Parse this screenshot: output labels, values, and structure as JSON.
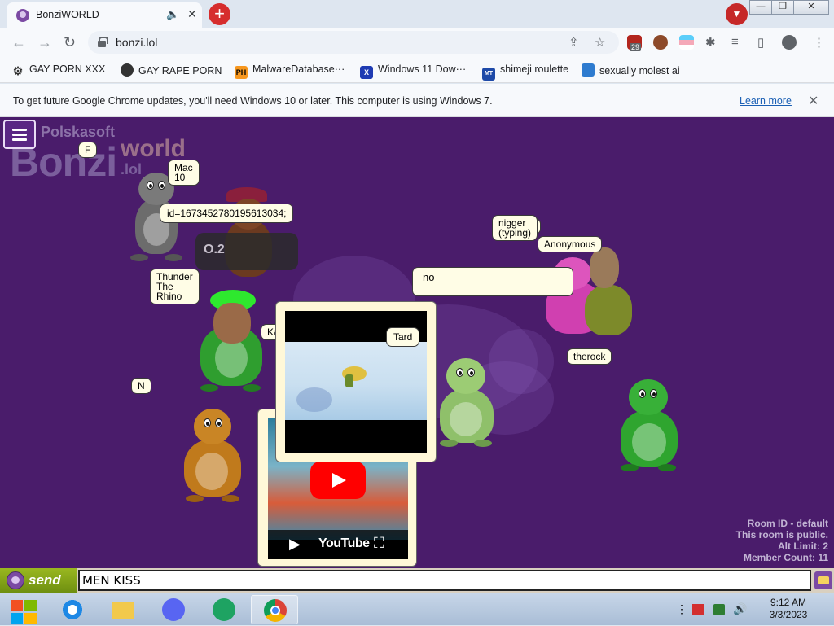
{
  "browser": {
    "tab_title": "BonziWORLD",
    "url": "bonzi.lol",
    "extension_badge": "29",
    "window_controls": {
      "minimize": "—",
      "maximize": "❐",
      "close": "✕"
    }
  },
  "bookmarks": [
    {
      "label": "GAY PORN XXX",
      "icon": "gear-icon"
    },
    {
      "label": "GAY RAPE PORN",
      "icon": "globe-icon"
    },
    {
      "label": "MalwareDatabase···",
      "icon": "ph-icon",
      "icon_text": "PH"
    },
    {
      "label": "Windows 11 Dow···",
      "icon": "x-icon",
      "icon_text": "X"
    },
    {
      "label": "shimeji roulette",
      "icon": "shimeji-icon",
      "icon_text": "MT"
    },
    {
      "label": "sexually molest ai",
      "icon": "ai-icon"
    }
  ],
  "infobar": {
    "text": "To get future Google Chrome updates, you'll need Windows 10 or later. This computer is using Windows 7.",
    "link": "Learn more"
  },
  "page": {
    "logo": {
      "top": "Polskasoft",
      "main": "Bonzi",
      "world": "world",
      "lol": ".lol"
    },
    "bubbles": {
      "f": "F",
      "mac": "Mac\n10",
      "id": "id=1673452780195613034;",
      "thunder": "Thunder\nThe\nRhino",
      "k": "Ka",
      "n": "N",
      "nigger": "nigger\n(typing)",
      "p": "P",
      "anonymous": "Anonymous",
      "no": "no",
      "tard": "Tard",
      "therock": "therock"
    },
    "overlay_text": "O.2",
    "youtube": {
      "logo": "YouTube"
    },
    "room_info": {
      "room_id": "Room ID - default",
      "status": "This room is public.",
      "alt_limit": "Alt Limit: 2",
      "member_count": "Member Count: 11"
    }
  },
  "chat": {
    "send_label": "send",
    "input_value": "MEN KISS"
  },
  "taskbar": {
    "time": "9:12 AM",
    "date": "3/3/2023"
  },
  "colors": {
    "page_bg": "#4a1c6b",
    "bubble_bg": "#fffde6",
    "bonzi_purple": "#7b4aa3",
    "send_green": "#7e9f14"
  }
}
